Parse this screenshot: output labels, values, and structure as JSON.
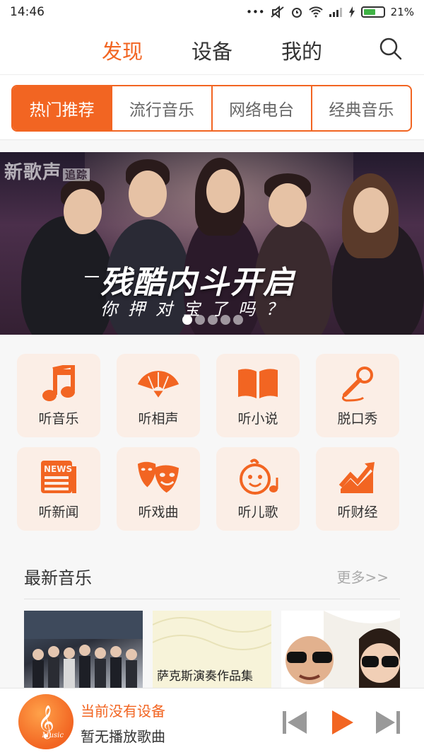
{
  "status_bar": {
    "time": "14:46",
    "battery": "21%"
  },
  "top_nav": {
    "tabs": [
      "发现",
      "设备",
      "我的"
    ],
    "active_index": 0
  },
  "categories": {
    "items": [
      "热门推荐",
      "流行音乐",
      "网络电台",
      "经典音乐"
    ],
    "active_index": 0
  },
  "banner": {
    "brand": "新歌声",
    "brand_tag": "追踪",
    "headline": "残酷内斗开启",
    "subline": "你押对宝了吗？",
    "page_count": 5,
    "current_page": 0
  },
  "features": [
    {
      "label": "听音乐",
      "icon": "music-note-icon"
    },
    {
      "label": "听相声",
      "icon": "fan-icon"
    },
    {
      "label": "听小说",
      "icon": "book-icon"
    },
    {
      "label": "脱口秀",
      "icon": "microphone-icon"
    },
    {
      "label": "听新闻",
      "icon": "newspaper-icon"
    },
    {
      "label": "听戏曲",
      "icon": "opera-mask-icon"
    },
    {
      "label": "听儿歌",
      "icon": "child-face-icon"
    },
    {
      "label": "听财经",
      "icon": "chart-up-icon"
    }
  ],
  "latest": {
    "title": "最新音乐",
    "more": "更多>>",
    "albums": [
      {
        "caption": ""
      },
      {
        "caption": "萨克斯演奏作品集"
      },
      {
        "caption": ""
      }
    ]
  },
  "player": {
    "device_status": "当前没有设备",
    "song_status": "暂无播放歌曲",
    "logo_text": "Music"
  },
  "colors": {
    "accent": "#f26522",
    "tile_bg": "#fbeee6"
  }
}
